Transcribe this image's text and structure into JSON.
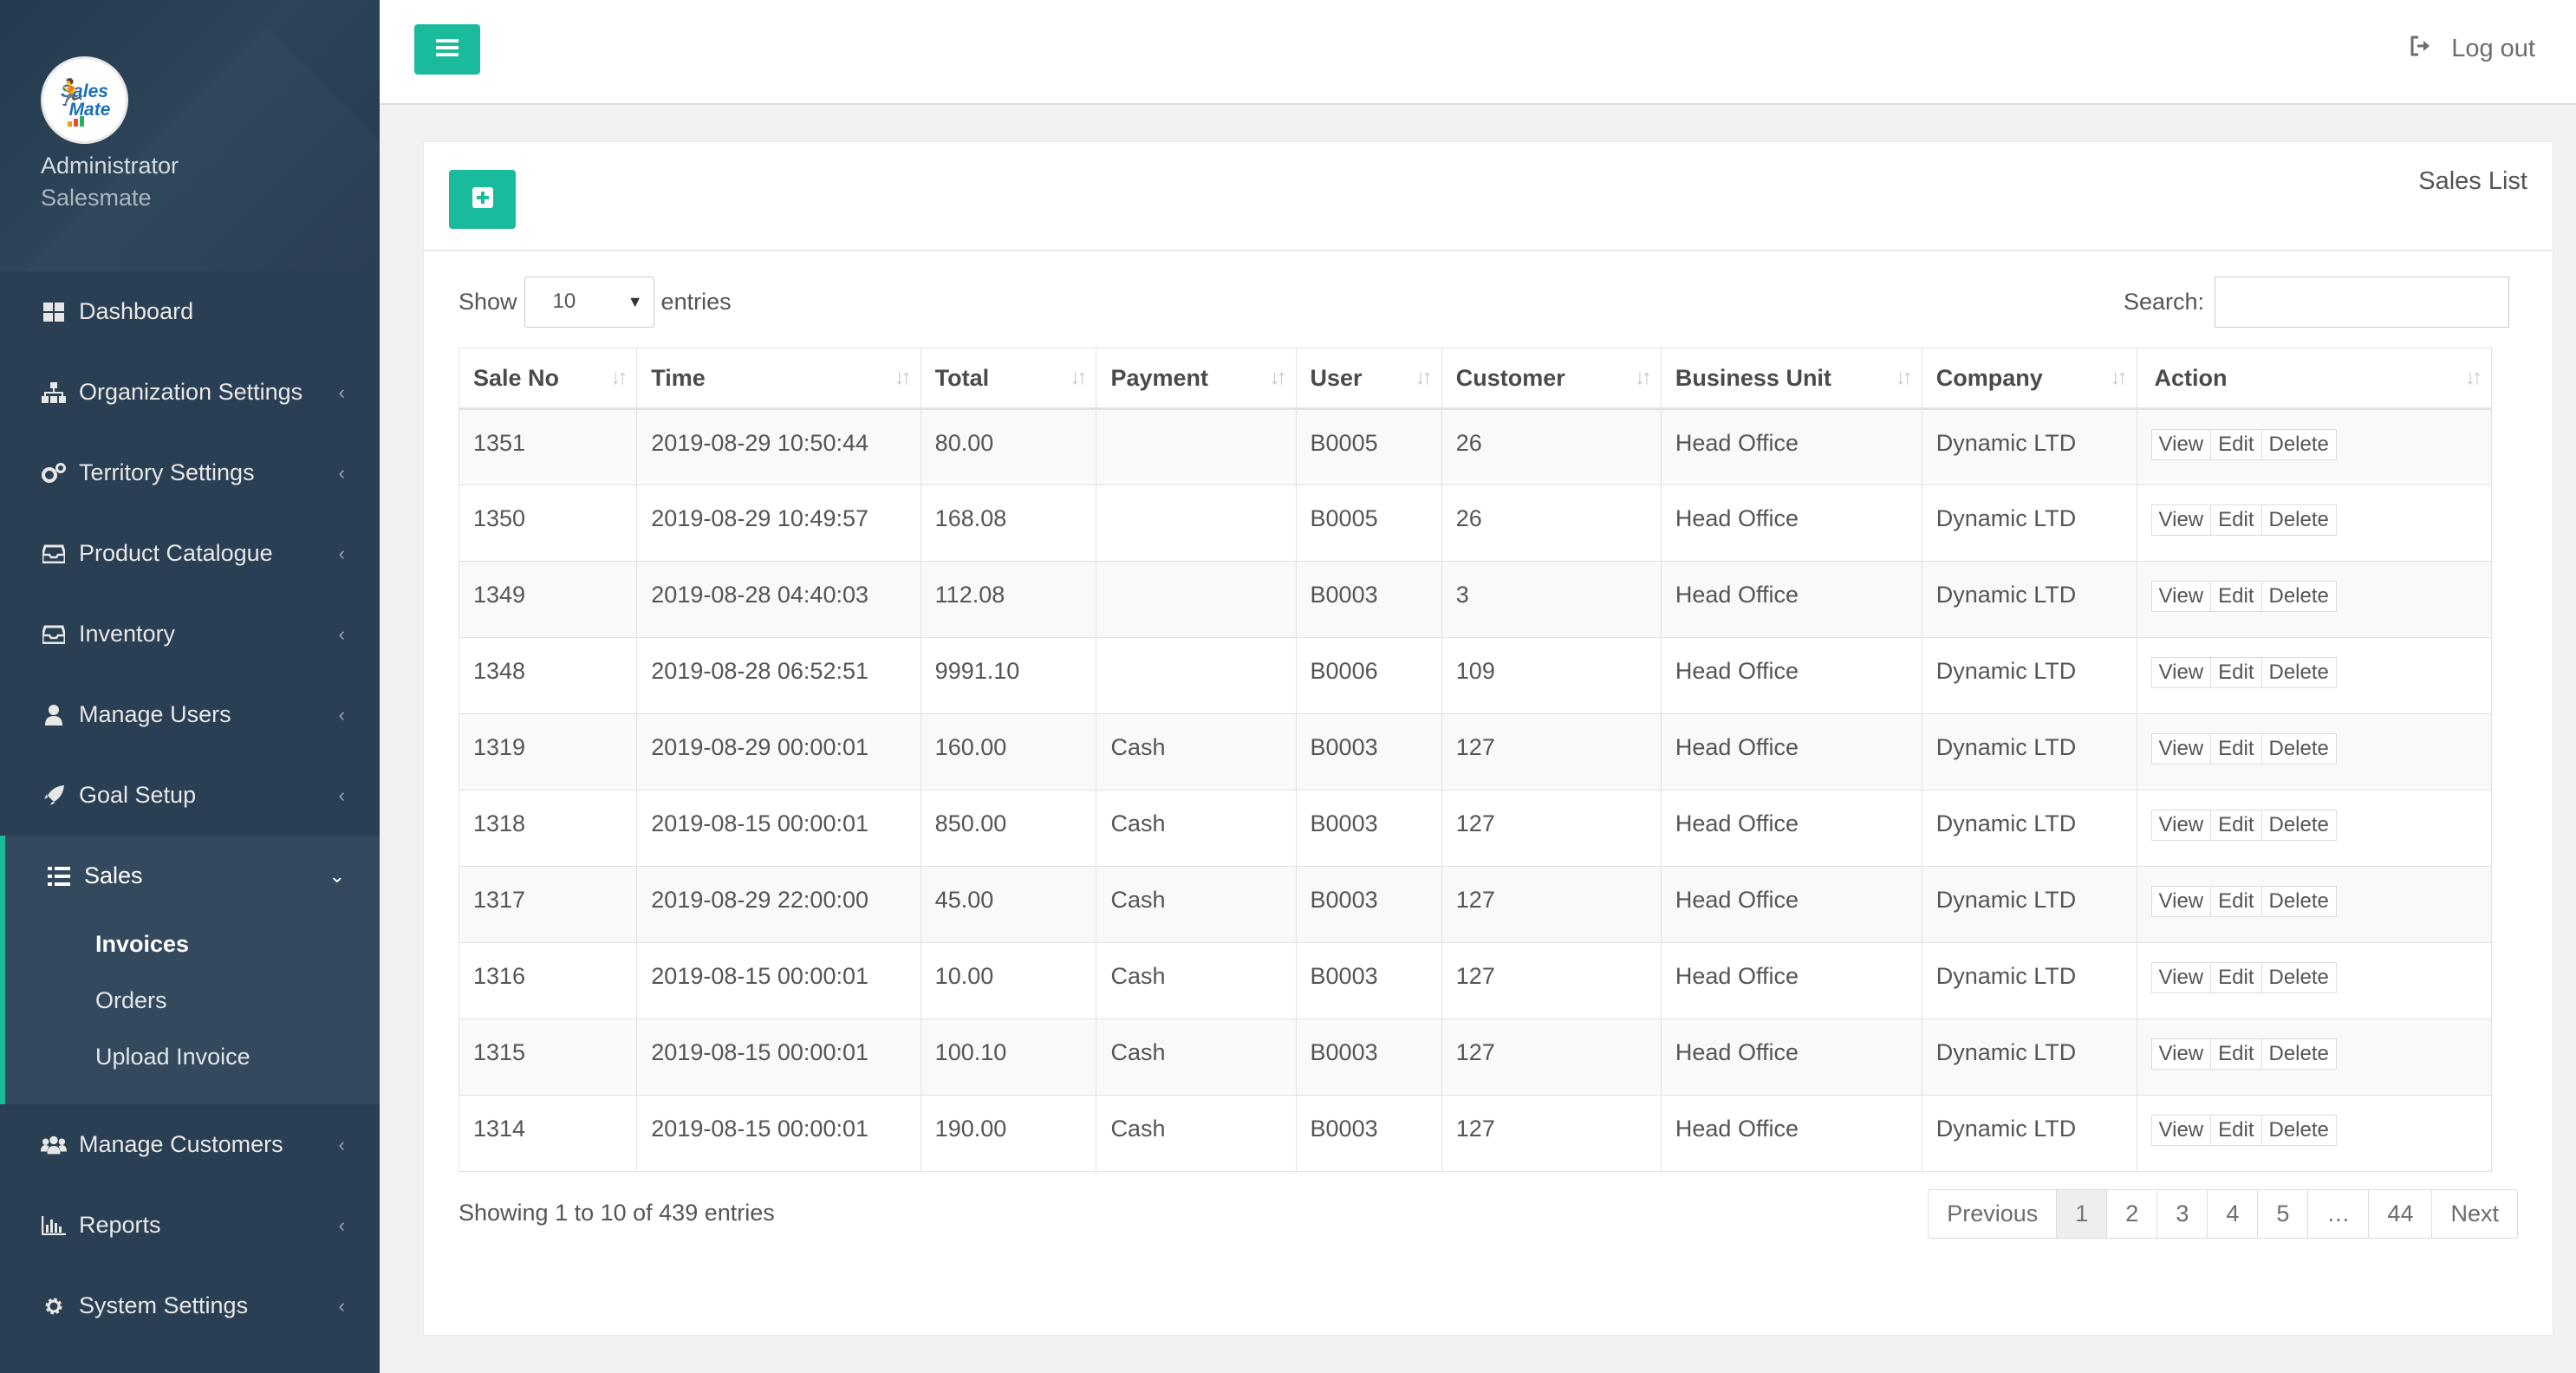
{
  "sidebar": {
    "logo_text": [
      "Sales",
      "Mate"
    ],
    "user_role": "Administrator",
    "user_company": "Salesmate",
    "items": [
      {
        "label": "Dashboard",
        "icon": "dashboard-icon"
      },
      {
        "label": "Organization Settings",
        "icon": "sitemap-icon"
      },
      {
        "label": "Territory Settings",
        "icon": "cogs-icon"
      },
      {
        "label": "Product Catalogue",
        "icon": "inbox-icon"
      },
      {
        "label": "Inventory",
        "icon": "inbox-icon"
      },
      {
        "label": "Manage Users",
        "icon": "user-icon"
      },
      {
        "label": "Goal Setup",
        "icon": "rocket-icon"
      },
      {
        "label": "Sales",
        "icon": "list-icon"
      },
      {
        "label": "Manage Customers",
        "icon": "users-icon"
      },
      {
        "label": "Reports",
        "icon": "bar-chart-icon"
      },
      {
        "label": "System Settings",
        "icon": "gear-icon"
      }
    ],
    "sales_submenu": [
      "Invoices",
      "Orders",
      "Upload Invoice"
    ]
  },
  "topbar": {
    "logout_label": "Log out"
  },
  "panel": {
    "title": "Sales List"
  },
  "controls": {
    "show_label": "Show",
    "entries_value": "10",
    "entries_label": "entries",
    "search_label": "Search:",
    "search_value": ""
  },
  "table": {
    "columns": [
      "Sale No",
      "Time",
      "Total",
      "Payment",
      "User",
      "Customer",
      "Business Unit",
      "Company",
      "Action"
    ],
    "rows": [
      [
        "1351",
        "2019-08-29 10:50:44",
        "80.00",
        "",
        "B0005",
        "26",
        "Head Office",
        "Dynamic LTD"
      ],
      [
        "1350",
        "2019-08-29 10:49:57",
        "168.08",
        "",
        "B0005",
        "26",
        "Head Office",
        "Dynamic LTD"
      ],
      [
        "1349",
        "2019-08-28 04:40:03",
        "112.08",
        "",
        "B0003",
        "3",
        "Head Office",
        "Dynamic LTD"
      ],
      [
        "1348",
        "2019-08-28 06:52:51",
        "9991.10",
        "",
        "B0006",
        "109",
        "Head Office",
        "Dynamic LTD"
      ],
      [
        "1319",
        "2019-08-29 00:00:01",
        "160.00",
        "Cash",
        "B0003",
        "127",
        "Head Office",
        "Dynamic LTD"
      ],
      [
        "1318",
        "2019-08-15 00:00:01",
        "850.00",
        "Cash",
        "B0003",
        "127",
        "Head Office",
        "Dynamic LTD"
      ],
      [
        "1317",
        "2019-08-29 22:00:00",
        "45.00",
        "Cash",
        "B0003",
        "127",
        "Head Office",
        "Dynamic LTD"
      ],
      [
        "1316",
        "2019-08-15 00:00:01",
        "10.00",
        "Cash",
        "B0003",
        "127",
        "Head Office",
        "Dynamic LTD"
      ],
      [
        "1315",
        "2019-08-15 00:00:01",
        "100.10",
        "Cash",
        "B0003",
        "127",
        "Head Office",
        "Dynamic LTD"
      ],
      [
        "1314",
        "2019-08-15 00:00:01",
        "190.00",
        "Cash",
        "B0003",
        "127",
        "Head Office",
        "Dynamic LTD"
      ]
    ],
    "actions": [
      "View",
      "Edit",
      "Delete"
    ]
  },
  "footer": {
    "info": "Showing 1 to 10 of 439 entries",
    "pages": [
      "Previous",
      "1",
      "2",
      "3",
      "4",
      "5",
      "…",
      "44",
      "Next"
    ],
    "current_page": "1"
  },
  "colors": {
    "accent": "#1abb9c",
    "sidebar": "#2a3f54"
  }
}
